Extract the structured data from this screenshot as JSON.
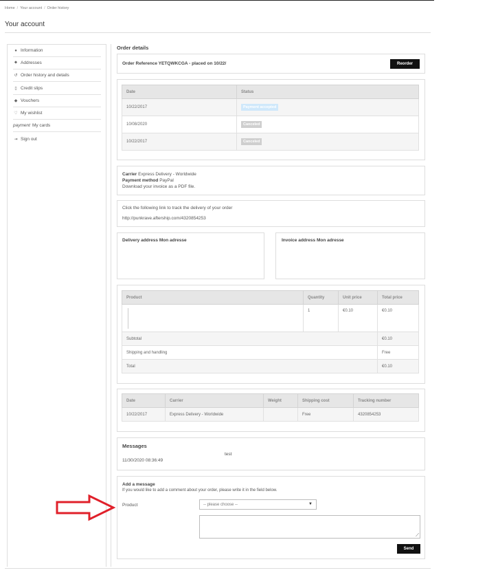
{
  "breadcrumb": {
    "items": [
      "Home",
      "Your account",
      "Order history"
    ]
  },
  "page": {
    "title": "Your account"
  },
  "sidebar": {
    "items": [
      {
        "icon": "user-icon",
        "label": "Information"
      },
      {
        "icon": "map-marker-icon",
        "label": "Addresses"
      },
      {
        "icon": "history-icon",
        "label": "Order history and details"
      },
      {
        "icon": "file-icon",
        "label": "Credit slips"
      },
      {
        "icon": "tags-icon",
        "label": "Vouchers"
      },
      {
        "icon": "heart-icon",
        "label": "My wishlist"
      },
      {
        "prefix": "payment",
        "label": "My cards"
      },
      {
        "icon": "sign-out-icon",
        "label": "Sign out"
      }
    ]
  },
  "order": {
    "section_title": "Order details",
    "reference_text": "Order Reference YETQWKCGA - placed on 10/22/",
    "reorder_label": "Reorder"
  },
  "status_table": {
    "headers": [
      "Date",
      "Status"
    ],
    "rows": [
      {
        "date": "10/22/2017",
        "status": "Payment accepted",
        "color": "#cfe8fb"
      },
      {
        "date": "10/08/2020",
        "status": "Canceled",
        "color": "#cfcfcf"
      },
      {
        "date": "10/22/2017",
        "status": "Canceled",
        "color": "#cfcfcf"
      }
    ]
  },
  "carrier_info": {
    "carrier_label": "Carrier",
    "carrier_value": "Express Delivery - Worldwide",
    "payment_label": "Payment method",
    "payment_value": "PayPal",
    "invoice_text": "Download your invoice as a PDF file."
  },
  "tracking_box": {
    "line1": "Click the following link to track the delivery of your order",
    "link": "http://punkrave.aftership.com/4320854253"
  },
  "addresses": {
    "delivery_title": "Delivery address Mon adresse",
    "invoice_title": "Invoice address Mon adresse"
  },
  "products_table": {
    "headers": [
      "Product",
      "Quantity",
      "Unit price",
      "Total price"
    ],
    "row": {
      "quantity": "1",
      "unit_price": "€0.10",
      "total_price": "€0.10"
    },
    "subtotal_label": "Subtotal",
    "subtotal_value": "€0.10",
    "shipping_label": "Shipping and handling",
    "shipping_value": "Free",
    "total_label": "Total",
    "total_value": "€0.10"
  },
  "shipping_table": {
    "headers": [
      "Date",
      "Carrier",
      "Weight",
      "Shipping cost",
      "Tracking number"
    ],
    "row": {
      "date": "10/22/2017",
      "carrier": "Express Delivery - Worldwide",
      "weight": "",
      "cost": "Free",
      "tracking": "4320854253"
    }
  },
  "messages": {
    "title": "Messages",
    "items": [
      {
        "timestamp": "11/30/2020 08:36:49",
        "text": "test"
      }
    ]
  },
  "add_message": {
    "title": "Add a message",
    "subtitle": "If you would like to add a comment about your order, please write it in the field below.",
    "product_label": "Product",
    "select_value": "-- please choose --",
    "send_label": "Send"
  },
  "colors": {
    "annotation_arrow": "#e0202a",
    "button_bg": "#111111"
  }
}
